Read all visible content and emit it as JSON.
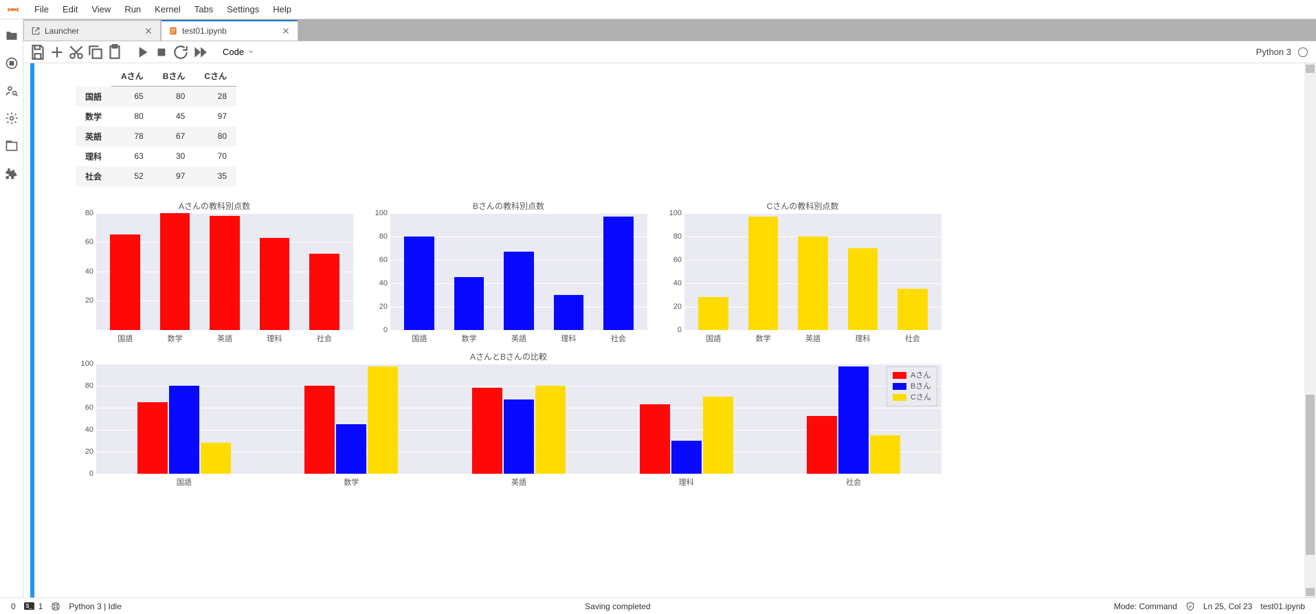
{
  "menubar": {
    "items": [
      "File",
      "Edit",
      "View",
      "Run",
      "Kernel",
      "Tabs",
      "Settings",
      "Help"
    ]
  },
  "activitybar": {
    "icons": [
      "folder-icon",
      "circle-stop-icon",
      "user-search-icon",
      "gear-icon",
      "tab-icon",
      "puzzle-icon"
    ]
  },
  "tabs": [
    {
      "label": "Launcher",
      "active": false,
      "icon": "external-link-icon"
    },
    {
      "label": "test01.ipynb",
      "active": true,
      "icon": "notebook-icon"
    }
  ],
  "toolbar": {
    "cell_type": "Code",
    "kernel_label": "Python 3"
  },
  "table": {
    "columns": [
      "Aさん",
      "Bさん",
      "Cさん"
    ],
    "rows": [
      {
        "label": "国語",
        "values": [
          65,
          80,
          28
        ]
      },
      {
        "label": "数学",
        "values": [
          80,
          45,
          97
        ]
      },
      {
        "label": "英語",
        "values": [
          78,
          67,
          80
        ]
      },
      {
        "label": "理科",
        "values": [
          63,
          30,
          70
        ]
      },
      {
        "label": "社会",
        "values": [
          52,
          97,
          35
        ]
      }
    ]
  },
  "chart_data": [
    {
      "type": "bar",
      "title": "Aさんの教科別点数",
      "categories": [
        "国語",
        "数学",
        "英語",
        "理科",
        "社会"
      ],
      "values": [
        65,
        80,
        78,
        63,
        52
      ],
      "color": "red",
      "ylim": [
        0,
        80
      ],
      "yticks": [
        20,
        40,
        60,
        80
      ],
      "xlabel": "",
      "ylabel": ""
    },
    {
      "type": "bar",
      "title": "Bさんの教科別点数",
      "categories": [
        "国語",
        "数学",
        "英語",
        "理科",
        "社会"
      ],
      "values": [
        80,
        45,
        67,
        30,
        97
      ],
      "color": "blue",
      "ylim": [
        0,
        100
      ],
      "yticks": [
        0,
        20,
        40,
        60,
        80,
        100
      ],
      "xlabel": "",
      "ylabel": ""
    },
    {
      "type": "bar",
      "title": "Cさんの教科別点数",
      "categories": [
        "国語",
        "数学",
        "英語",
        "理科",
        "社会"
      ],
      "values": [
        28,
        97,
        80,
        70,
        35
      ],
      "color": "yellow",
      "ylim": [
        0,
        100
      ],
      "yticks": [
        0,
        20,
        40,
        60,
        80,
        100
      ],
      "xlabel": "",
      "ylabel": ""
    },
    {
      "type": "bar",
      "title": "AさんとBさんの比較",
      "categories": [
        "国語",
        "数学",
        "英語",
        "理科",
        "社会"
      ],
      "series": [
        {
          "name": "Aさん",
          "values": [
            65,
            80,
            78,
            63,
            52
          ],
          "color": "red"
        },
        {
          "name": "Bさん",
          "values": [
            80,
            45,
            67,
            30,
            97
          ],
          "color": "blue"
        },
        {
          "name": "Cさん",
          "values": [
            28,
            97,
            80,
            70,
            35
          ],
          "color": "yellow"
        }
      ],
      "ylim": [
        0,
        100
      ],
      "yticks": [
        0,
        20,
        40,
        60,
        80,
        100
      ],
      "xlabel": "",
      "ylabel": ""
    }
  ],
  "statusbar": {
    "left0": "0",
    "terminals": "1",
    "kernel_status": "Python 3 | Idle",
    "center": "Saving completed",
    "mode": "Mode: Command",
    "cursor": "Ln 25, Col 23",
    "filename": "test01.ipynb"
  },
  "colors": {
    "red": "#FF0808",
    "blue": "#0909FF",
    "yellow": "#FFDC00",
    "plot_bg": "#EAEAF2"
  }
}
